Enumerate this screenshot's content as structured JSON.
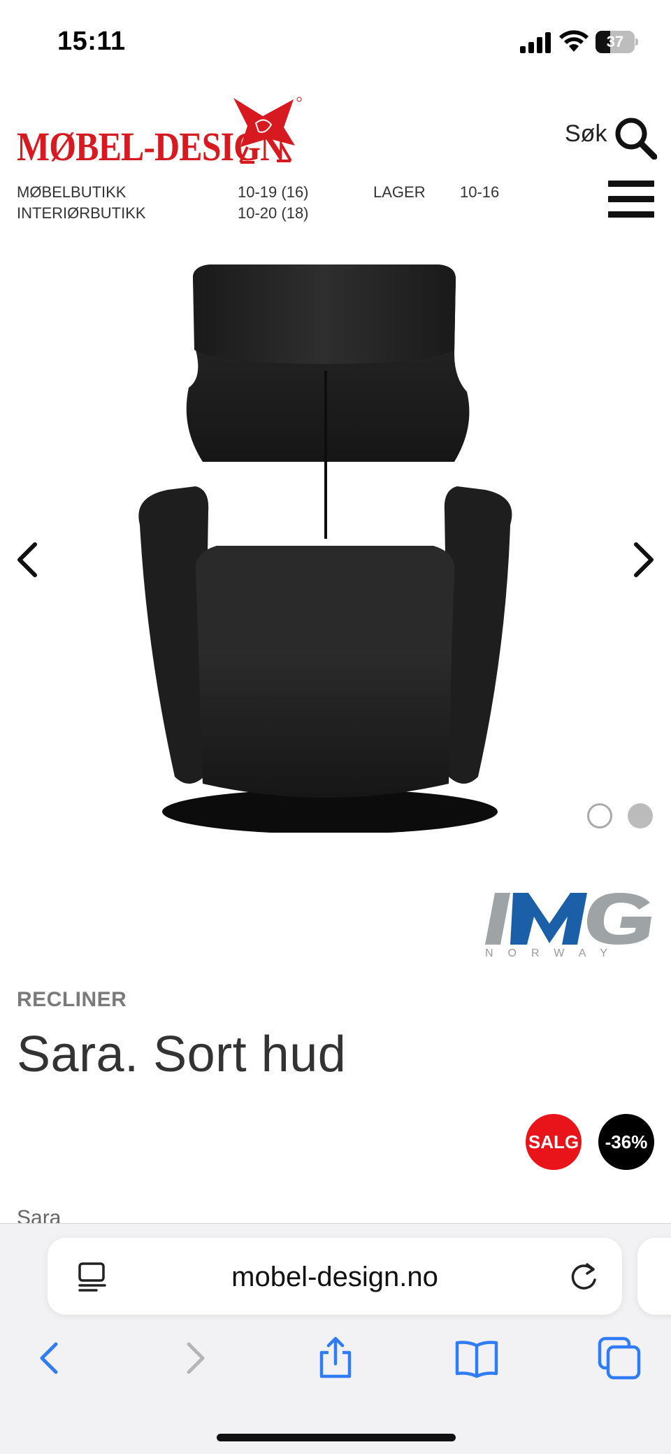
{
  "status_bar": {
    "time": "15:11",
    "battery_level": "37",
    "battery_fraction": 0.37
  },
  "header": {
    "logo_text": "MØBEL-DESIGN",
    "search_label": "Søk",
    "hours": [
      {
        "label": "MØBELBUTIKK",
        "hours": "10-19 (16)",
        "label2": "LAGER",
        "hours2": "10-16"
      },
      {
        "label": "INTERIØRBUTIKK",
        "hours": "10-20 (18)",
        "label2": "",
        "hours2": ""
      }
    ]
  },
  "gallery": {
    "image_count": 2,
    "active_index": 1
  },
  "product": {
    "brand_name": "IMG",
    "brand_sub": "NORWAY",
    "category": "RECLINER",
    "title": "Sara. Sort hud",
    "badges": {
      "sale": "SALG",
      "discount": "-36%"
    },
    "subtitle_peek": "Sara"
  },
  "browser": {
    "url": "mobel-design.no"
  },
  "colors": {
    "brand_red": "#d71920",
    "sale_badge": "#e8141a",
    "ios_blue": "#2f7cf6",
    "img_blue": "#1b5fa8",
    "img_grey": "#9ea3a6"
  },
  "icons": {
    "search": "search-icon",
    "menu": "menu-icon",
    "prev": "chevron-left-icon",
    "next": "chevron-right-icon",
    "reader": "reader-icon",
    "reload": "reload-icon",
    "back": "back-icon",
    "forward": "forward-icon",
    "share": "share-icon",
    "bookmarks": "bookmarks-icon",
    "tabs": "tabs-icon"
  }
}
